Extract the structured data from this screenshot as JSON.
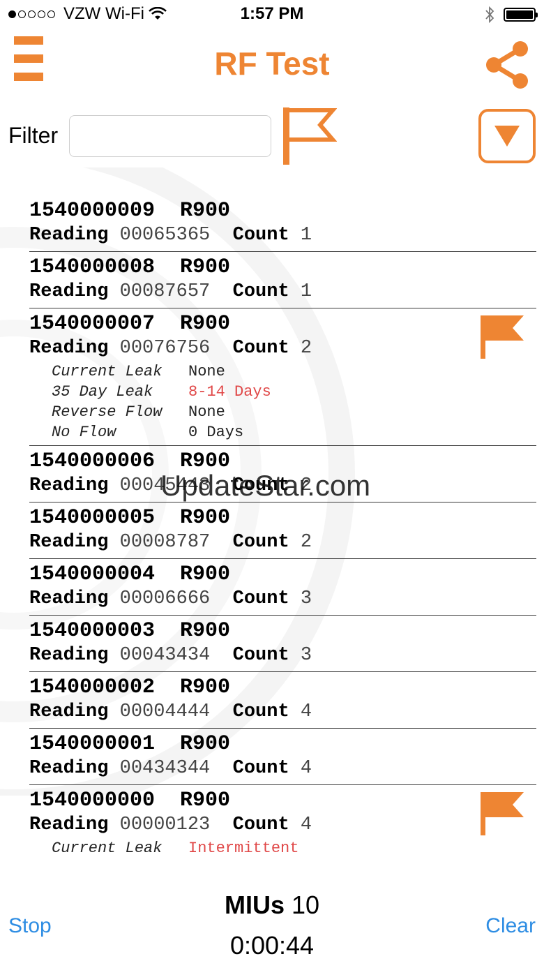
{
  "status_bar": {
    "carrier": "VZW Wi-Fi",
    "time": "1:57 PM",
    "signal_dots_filled": 1,
    "signal_dots_total": 5
  },
  "header": {
    "title": "RF Test",
    "menu_icon": "hamburger-menu-icon",
    "share_icon": "share-icon"
  },
  "filter": {
    "label": "Filter",
    "value": "",
    "placeholder": ""
  },
  "colors": {
    "accent": "#EE8533",
    "link": "#2E8DE3",
    "alert": "#E04848"
  },
  "items": [
    {
      "id": "1540000009",
      "model": "R900",
      "reading_label": "Reading",
      "reading": "00065365",
      "count_label": "Count",
      "count": "1",
      "flagged": false,
      "details": []
    },
    {
      "id": "1540000008",
      "model": "R900",
      "reading_label": "Reading",
      "reading": "00087657",
      "count_label": "Count",
      "count": "1",
      "flagged": false,
      "details": []
    },
    {
      "id": "1540000007",
      "model": "R900",
      "reading_label": "Reading",
      "reading": "00076756",
      "count_label": "Count",
      "count": "2",
      "flagged": true,
      "details": [
        {
          "key": "Current Leak",
          "value": "None",
          "alert": false
        },
        {
          "key": "35 Day Leak",
          "value": "8-14 Days",
          "alert": true
        },
        {
          "key": "Reverse Flow",
          "value": "None",
          "alert": false
        },
        {
          "key": "No Flow",
          "value": "0 Days",
          "alert": false
        }
      ]
    },
    {
      "id": "1540000006",
      "model": "R900",
      "reading_label": "Reading",
      "reading": "00045443",
      "count_label": "Count",
      "count": "2",
      "flagged": false,
      "details": []
    },
    {
      "id": "1540000005",
      "model": "R900",
      "reading_label": "Reading",
      "reading": "00008787",
      "count_label": "Count",
      "count": "2",
      "flagged": false,
      "details": []
    },
    {
      "id": "1540000004",
      "model": "R900",
      "reading_label": "Reading",
      "reading": "00006666",
      "count_label": "Count",
      "count": "3",
      "flagged": false,
      "details": []
    },
    {
      "id": "1540000003",
      "model": "R900",
      "reading_label": "Reading",
      "reading": "00043434",
      "count_label": "Count",
      "count": "3",
      "flagged": false,
      "details": []
    },
    {
      "id": "1540000002",
      "model": "R900",
      "reading_label": "Reading",
      "reading": "00004444",
      "count_label": "Count",
      "count": "4",
      "flagged": false,
      "details": []
    },
    {
      "id": "1540000001",
      "model": "R900",
      "reading_label": "Reading",
      "reading": "00434344",
      "count_label": "Count",
      "count": "4",
      "flagged": false,
      "details": []
    },
    {
      "id": "1540000000",
      "model": "R900",
      "reading_label": "Reading",
      "reading": "00000123",
      "count_label": "Count",
      "count": "4",
      "flagged": true,
      "details": [
        {
          "key": "Current Leak",
          "value": "Intermittent",
          "alert": true
        }
      ]
    }
  ],
  "footer": {
    "stop_label": "Stop",
    "clear_label": "Clear",
    "mius_label": "MIUs",
    "mius_count": "10",
    "timer": "0:00:44"
  },
  "watermark": "UpdateStar.com"
}
